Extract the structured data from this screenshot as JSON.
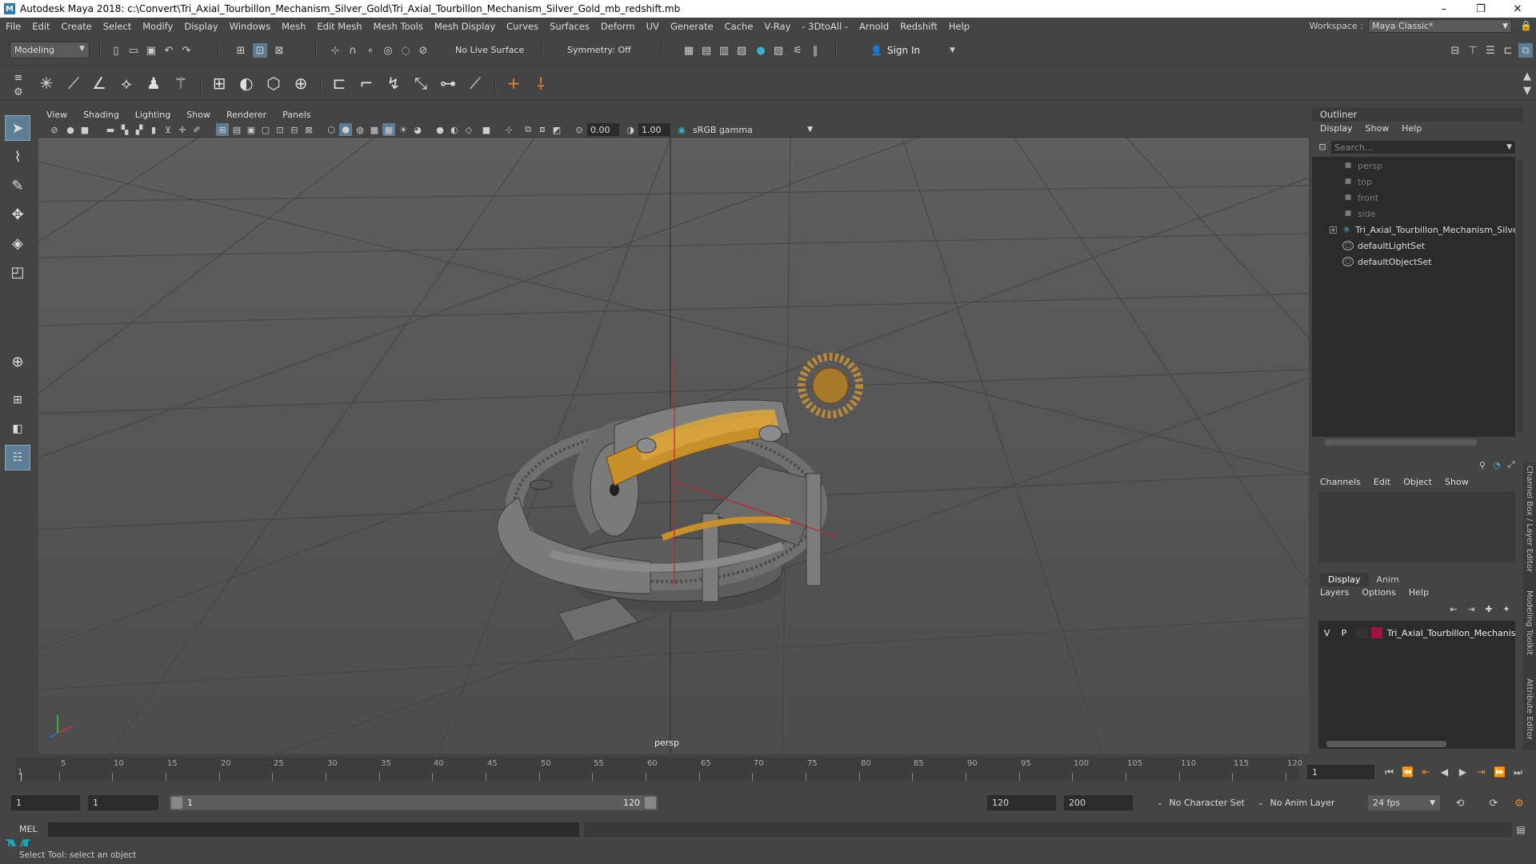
{
  "window": {
    "title": "Autodesk Maya 2018: c:\\Convert\\Tri_Axial_Tourbillon_Mechanism_Silver_Gold\\Tri_Axial_Tourbillon_Mechanism_Silver_Gold_mb_redshift.mb",
    "minimize": "–",
    "maximize": "❐",
    "close": "✕"
  },
  "menubar": {
    "items": [
      "File",
      "Edit",
      "Create",
      "Select",
      "Modify",
      "Display",
      "Windows",
      "Mesh",
      "Edit Mesh",
      "Mesh Tools",
      "Mesh Display",
      "Curves",
      "Surfaces",
      "Deform",
      "UV",
      "Generate",
      "Cache",
      "V-Ray",
      "- 3DtoAll -",
      "Arnold",
      "Redshift",
      "Help"
    ],
    "workspace_label": "Workspace :",
    "workspace_value": "Maya Classic*"
  },
  "statusline": {
    "mode": "Modeling",
    "live_surface": "No Live Surface",
    "symmetry": "Symmetry: Off",
    "sign_in": "Sign In"
  },
  "viewport": {
    "menus": [
      "View",
      "Shading",
      "Lighting",
      "Show",
      "Renderer",
      "Panels"
    ],
    "exposure": "0.00",
    "gamma": "1.00",
    "color_space": "sRGB gamma",
    "camera": "persp"
  },
  "outliner": {
    "title": "Outliner",
    "menus": [
      "Display",
      "Show",
      "Help"
    ],
    "search_placeholder": "Search...",
    "items": [
      {
        "label": "persp",
        "icon": "camera-icon",
        "dim": true
      },
      {
        "label": "top",
        "icon": "camera-icon",
        "dim": true
      },
      {
        "label": "front",
        "icon": "camera-icon",
        "dim": true
      },
      {
        "label": "side",
        "icon": "camera-icon",
        "dim": true
      },
      {
        "label": "Tri_Axial_Tourbillon_Mechanism_Silver_G",
        "icon": "group-icon",
        "dim": false
      },
      {
        "label": "defaultLightSet",
        "icon": "set-icon",
        "dim": false
      },
      {
        "label": "defaultObjectSet",
        "icon": "set-icon",
        "dim": false
      }
    ]
  },
  "channelbox": {
    "menus": [
      "Channels",
      "Edit",
      "Object",
      "Show"
    ]
  },
  "layereditor": {
    "tabs": [
      "Display",
      "Anim"
    ],
    "menus": [
      "Layers",
      "Options",
      "Help"
    ],
    "layer": {
      "v": "V",
      "p": "P",
      "name": "Tri_Axial_Tourbillon_Mechanisr",
      "color": "#a0143c"
    }
  },
  "side_tabs": [
    "Channel Box / Layer Editor",
    "Modeling Toolkit",
    "Attribute Editor"
  ],
  "timeline": {
    "ticks": [
      "5",
      "10",
      "15",
      "20",
      "25",
      "30",
      "35",
      "40",
      "45",
      "50",
      "55",
      "60",
      "65",
      "70",
      "75",
      "80",
      "85",
      "90",
      "95",
      "100",
      "105",
      "110",
      "115",
      "120"
    ],
    "start_tick": "1",
    "current_frame": "1"
  },
  "range": {
    "start": "1",
    "playback_start": "1",
    "slider_start": "1",
    "slider_end": "120",
    "playback_end": "120",
    "end": "200",
    "character_set": "No Character Set",
    "anim_layer": "No Anim Layer",
    "fps": "24 fps"
  },
  "commandline": {
    "label": "MEL"
  },
  "helpline": {
    "text": "Select Tool: select an object"
  },
  "colors": {
    "accent": "#5d7d96",
    "gold": "#c8902a",
    "red_axis": "#c0262d"
  }
}
